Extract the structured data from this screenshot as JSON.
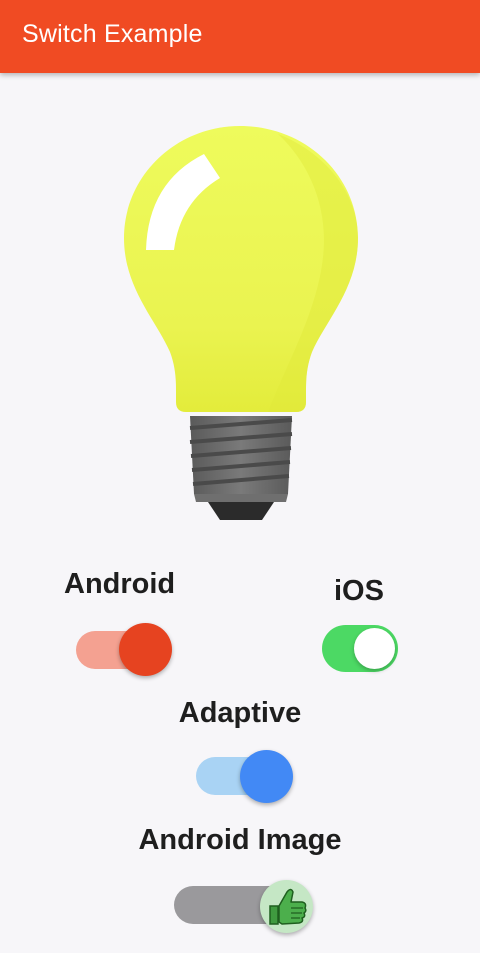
{
  "appbar": {
    "title": "Switch Example",
    "color": "#f04b23"
  },
  "bulb": {
    "icon": "lightbulb-icon",
    "color": "#eef552"
  },
  "switches": {
    "android": {
      "label": "Android",
      "on": true,
      "active_color": "#e64320"
    },
    "ios": {
      "label": "iOS",
      "on": true,
      "active_color": "#4cd964"
    },
    "adaptive": {
      "label": "Adaptive",
      "on": true,
      "active_color": "#4289f5"
    },
    "image": {
      "label": "Android Image",
      "on": true,
      "thumb_icon": "thumbs-up-icon"
    }
  }
}
